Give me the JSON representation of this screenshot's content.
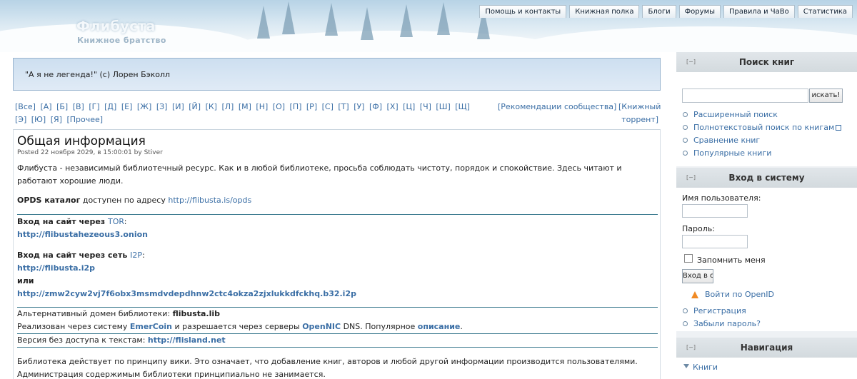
{
  "header": {
    "site_name": "Флибуста",
    "slogan": "Книжное братство",
    "nav": [
      "Помощь и контакты",
      "Книжная полка",
      "Блоги",
      "Форумы",
      "Правила и ЧаВо",
      "Статистика"
    ]
  },
  "quote": "\"А я не легенда!\" (с) Лорен Бэколл",
  "alphabet": [
    "[Все]",
    "[А]",
    "[Б]",
    "[В]",
    "[Г]",
    "[Д]",
    "[Е]",
    "[Ж]",
    "[З]",
    "[И]",
    "[Й]",
    "[К]",
    "[Л]",
    "[М]",
    "[Н]",
    "[О]",
    "[П]",
    "[Р]",
    "[С]",
    "[Т]",
    "[У]",
    "[Ф]",
    "[Х]",
    "[Ц]",
    "[Ч]",
    "[Ш]",
    "[Щ]",
    "[Э]",
    "[Ю]",
    "[Я]",
    "[Прочее]"
  ],
  "recommendations_link": "[Рекомендации сообщества]",
  "torrent_link_1": "[Книжный",
  "torrent_link_2": "торрент]",
  "node": {
    "title": "Общая информация",
    "meta": "Posted 22 ноября 2029, в 15:00:01 by Stiver",
    "intro": "Флибуста - независимый библиотечный ресурс. Как и в любой библиотеке, просьба соблюдать чистоту, порядок и спокойствие. Здесь читают и работают хорошие люди.",
    "opds_label": "OPDS каталог",
    "opds_text": " доступен по адресу ",
    "opds_url": "http://flibusta.is/opds",
    "tor_label": "Вход на сайт через ",
    "tor_link": "TOR",
    "tor_colon": ":",
    "tor_url": "http://flibustahezeous3.onion",
    "i2p_label": "Вход на сайт через сеть ",
    "i2p_link": "I2P",
    "i2p_colon": ":",
    "i2p_url": "http://flibusta.i2p",
    "or": "или",
    "i2p_url2": "http://zmw2cyw2vj7f6obx3msmdvdepdhnw2ctc4okza2zjxlukkdfckhq.b32.i2p",
    "alt_domain_label": "Альтернативный домен библиотеки: ",
    "alt_domain": "flibusta.lib",
    "emercoin_pre": "Реализован через систему ",
    "emercoin": "EmerCoin",
    "emercoin_mid": " и разрешается через серверы ",
    "opennic": "OpenNIC",
    "emercoin_post": " DNS. Популярное ",
    "description_link": "описание",
    "emercoin_end": ".",
    "nonaccess_label": "Версия без доступа к текстам: ",
    "nonaccess_url": "http://flisland.net",
    "wiki_text_1": "Библиотека действует по принципу вики. Это означает, что добавление книг, авторов и любой другой информации производится пользователями.",
    "wiki_text_2": "Администрация содержимым библиотеки принципиально не занимается."
  },
  "sidebar": {
    "search": {
      "toggle": "[−]",
      "title": "Поиск книг",
      "button": "искать!",
      "links": [
        "Расширенный поиск",
        "Полнотекстовый поиск по книгам",
        "Сравнение книг",
        "Популярные книги"
      ]
    },
    "login": {
      "toggle": "[−]",
      "title": "Вход в систему",
      "username_label": "Имя пользователя:",
      "password_label": "Пароль:",
      "remember": "Запомнить меня",
      "button": "Вход в с",
      "openid": "Войти по OpenID",
      "links": [
        "Регистрация",
        "Забыли пароль?"
      ]
    },
    "navigation": {
      "toggle": "[−]",
      "title": "Навигация",
      "first": "Книги"
    }
  }
}
